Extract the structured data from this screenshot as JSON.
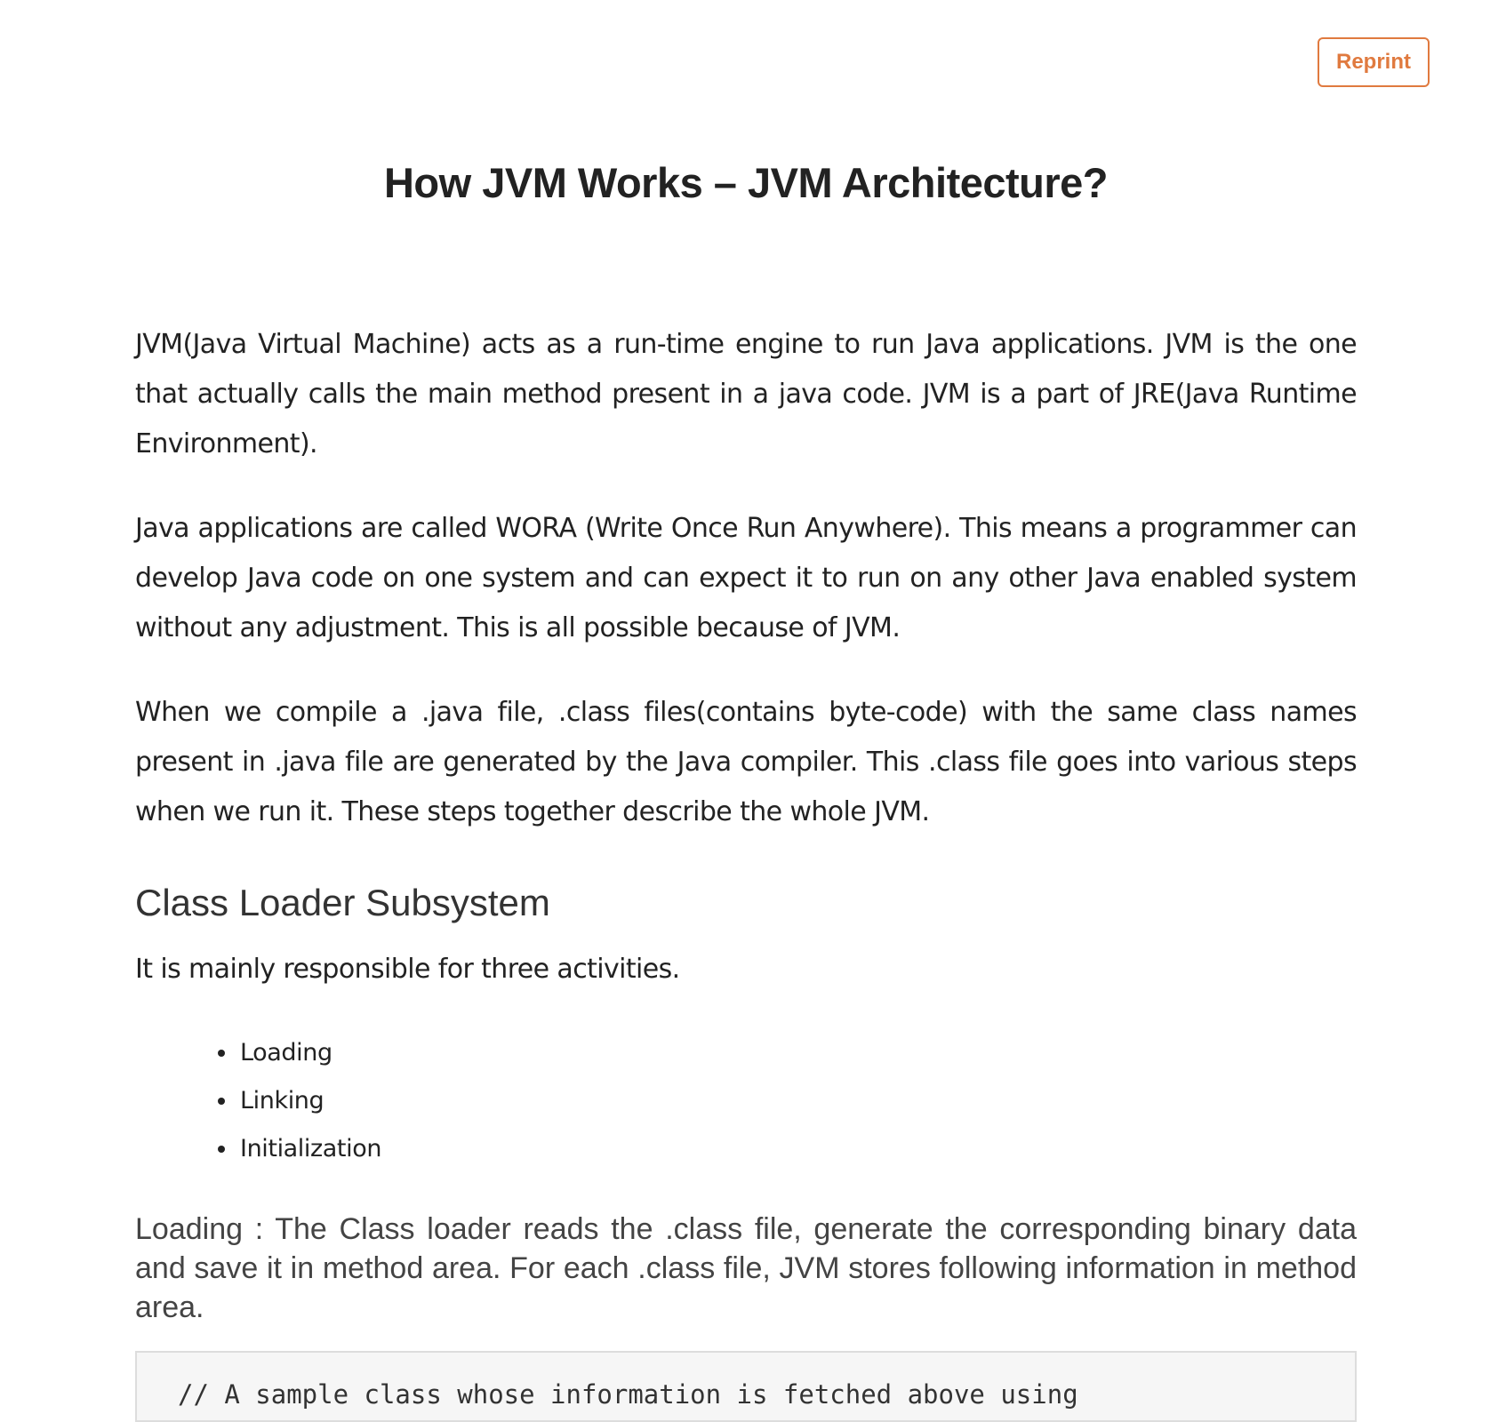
{
  "header": {
    "reprint_label": "Reprint"
  },
  "article": {
    "title": "How JVM Works – JVM Architecture?",
    "paragraphs": [
      "JVM(Java Virtual Machine) acts as a run-time engine to run Java applications. JVM is the one that actually calls the main method present in a java code. JVM is a part of JRE(Java Runtime Environment).",
      "Java applications are called WORA (Write Once Run Anywhere). This means a programmer can develop Java code on one system and can expect it to run on any other Java enabled system without any adjustment. This is all possible because of JVM.",
      "When we compile a .java file, .class files(contains byte-code) with the same class names present in .java file are generated by the Java compiler. This .class file goes into various steps when we run it. These steps together describe the whole JVM."
    ],
    "section_heading": "Class Loader Subsystem",
    "section_intro": "It is mainly responsible for three activities.",
    "activities": [
      "Loading",
      "Linking",
      "Initialization"
    ],
    "loading_description": "Loading : The Class loader reads the .class file, generate the corresponding binary data and save it in method area. For each .class file, JVM stores following information in method area.",
    "code_first_line": "// A sample class whose information is fetched above using"
  }
}
